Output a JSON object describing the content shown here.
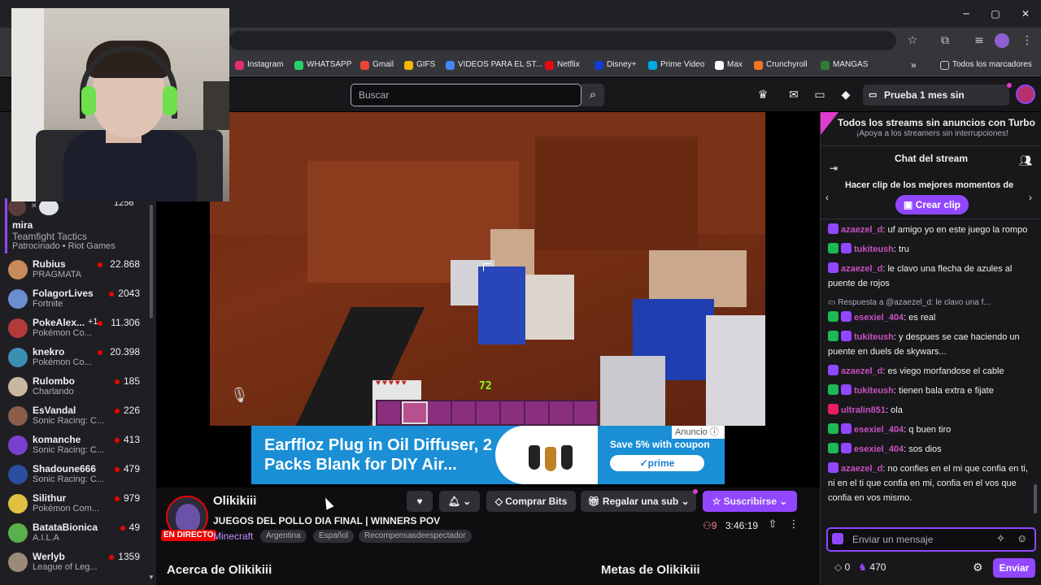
{
  "browser": {
    "bookmarks": [
      {
        "label": "Instagram",
        "color": "#e1306c"
      },
      {
        "label": "WHATSAPP",
        "color": "#25d366"
      },
      {
        "label": "Gmail",
        "color": "#ea4335"
      },
      {
        "label": "GIFS",
        "color": "#f4b400"
      },
      {
        "label": "VIDEOS PARA EL ST...",
        "color": "#4285f4"
      },
      {
        "label": "Netflix",
        "color": "#e50914"
      },
      {
        "label": "Disney+",
        "color": "#113ccf"
      },
      {
        "label": "Prime Video",
        "color": "#00a8e1"
      },
      {
        "label": "Max",
        "color": "#ffffff"
      },
      {
        "label": "Crunchyroll",
        "color": "#f47521"
      },
      {
        "label": "MANGAS",
        "color": "#2e7d32"
      }
    ],
    "all_bookmarks": "Todos los marcadores"
  },
  "nav": {
    "search_placeholder": "Buscar",
    "turbo_button": "Prueba 1 mes sin anuncios"
  },
  "sidebar": {
    "promo": {
      "count": "1256",
      "name": "mira",
      "game": "Teamfight Tactics",
      "sponsor": "Patrocinado • Riot Games"
    },
    "channels": [
      {
        "name": "Rubius",
        "game": "PRAGMATA",
        "viewers": "22.868",
        "color": "#c78a5a"
      },
      {
        "name": "FolagorLives",
        "game": "Fortnite",
        "viewers": "2043",
        "color": "#6a8ed0"
      },
      {
        "name": "PokeAlex...",
        "extra": "+1",
        "game": "Pokémon Co...",
        "viewers": "11.306",
        "color": "#b23a3a"
      },
      {
        "name": "knekro",
        "game": "Pokémon Co...",
        "viewers": "20.398",
        "color": "#3a8fb2"
      },
      {
        "name": "Rulombo",
        "game": "Charlando",
        "viewers": "185",
        "color": "#c9b8a0"
      },
      {
        "name": "EsVandal",
        "game": "Sonic Racing: C...",
        "viewers": "226",
        "color": "#8b5e4a"
      },
      {
        "name": "komanche",
        "game": "Sonic Racing: C...",
        "viewers": "413",
        "color": "#7b3fd0"
      },
      {
        "name": "Shadoune666",
        "game": "Sonic Racing: C...",
        "viewers": "479",
        "color": "#2a4fa0"
      },
      {
        "name": "Silithur",
        "game": "Pokémon Com...",
        "viewers": "979",
        "color": "#e0c040"
      },
      {
        "name": "BatataBionica",
        "game": "A.I.L.A",
        "viewers": "49",
        "color": "#5ab04a"
      },
      {
        "name": "Werlyb",
        "game": "League of Leg...",
        "viewers": "1359",
        "color": "#9a8a7a"
      }
    ]
  },
  "game_hud": {
    "xp_level": "72"
  },
  "ad": {
    "headline": "Earffloz Plug in Oil Diffuser, 2 Packs Blank for DIY Air...",
    "save": "Save 5% with coupon",
    "prime": "✓prime",
    "label": "Anuncio"
  },
  "stream": {
    "streamer": "Olikikiii",
    "title": "JUEGOS DEL POLLO DIA FINAL | WINNERS POV",
    "live": "EN DIRECTO",
    "game": "Minecraft",
    "tags": [
      "Argentina",
      "Español",
      "Recompensasdeespectador"
    ],
    "viewers": "9",
    "uptime": "3:46:19",
    "buttons": {
      "bits": "Comprar Bits",
      "gift": "Regalar una sub",
      "subscribe": "Suscribirse"
    },
    "about": "Acerca de Olikikiii",
    "goals": "Metas de Olikikiii"
  },
  "chat": {
    "turbo_title": "Todos los streams sin anuncios con Turbo",
    "turbo_sub": "¡Apoya a los streamers sin interrupciones!",
    "header": "Chat del stream",
    "clip_title": "Hacer clip de los mejores momentos de",
    "clip_button": "Crear clip",
    "messages": [
      {
        "user": "azaezel_d",
        "text": ": uf amigo yo en este juego la rompo",
        "badges": [
          "#9147ff"
        ]
      },
      {
        "user": "tukiteush",
        "text": ": tru",
        "badges": [
          "#1db954",
          "#9147ff"
        ]
      },
      {
        "user": "azaezel_d",
        "text": ": le clavo una flecha de azules al puente de rojos",
        "badges": [
          "#9147ff"
        ]
      },
      {
        "reply": "Respuesta a @azaezel_d: le clavo una f..."
      },
      {
        "user": "esexiel_404",
        "text": ": es real",
        "badges": [
          "#1db954",
          "#9147ff"
        ]
      },
      {
        "user": "tukiteush",
        "text": ": y despues se cae haciendo un puente en duels de skywars...",
        "badges": [
          "#1db954",
          "#9147ff"
        ]
      },
      {
        "user": "azaezel_d",
        "text": ": es viego morfandose el cable",
        "badges": [
          "#9147ff"
        ]
      },
      {
        "user": "tukiteush",
        "text": ": tienen bala extra e fijate",
        "badges": [
          "#1db954",
          "#9147ff"
        ]
      },
      {
        "user": "ultralin851",
        "text": ": ola",
        "badges": [
          "#e91e63"
        ]
      },
      {
        "user": "esexiel_404",
        "text": ": q buen tiro",
        "badges": [
          "#1db954",
          "#9147ff"
        ]
      },
      {
        "user": "esexiel_404",
        "text": ": sos dios",
        "badges": [
          "#1db954",
          "#9147ff"
        ]
      },
      {
        "user": "azaezel_d",
        "text": ": no confies en el mi que confia en ti, ni en el ti que confia en mi, confia en el vos que confia en vos mismo.",
        "badges": [
          "#9147ff"
        ]
      }
    ],
    "input_placeholder": "Enviar un mensaje",
    "bits": "0",
    "points": "470",
    "send": "Enviar"
  }
}
